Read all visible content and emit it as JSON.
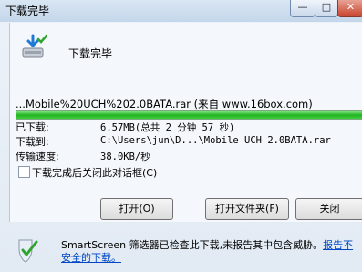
{
  "window": {
    "title": "下载完毕",
    "min_glyph": "—",
    "max_glyph": "□",
    "close_glyph": "✕"
  },
  "header": {
    "headline": "下载完毕"
  },
  "download": {
    "file_line": "...Mobile%20UCH%202.0BATA.rar (来自 www.16box.com)",
    "progress_fraction": 1.0,
    "rows": [
      {
        "label": "已下载:",
        "value": "6.57MB(总共 2 分钟 57 秒)"
      },
      {
        "label": "下载到:",
        "value": "C:\\Users\\jun\\D...\\Mobile UCH 2.0BATA.rar"
      },
      {
        "label": "传输速度:",
        "value": "38.0KB/秒"
      }
    ]
  },
  "options": {
    "close_after_download_label": "下载完成后关闭此对话框(C)",
    "close_after_download_checked": false
  },
  "buttons": {
    "open": "打开(O)",
    "open_folder": "打开文件夹(F)",
    "close": "关闭"
  },
  "smartscreen": {
    "text": "SmartScreen 筛选器已检查此下载,未报告其中包含威胁。",
    "link": "报告不安全的下载。"
  },
  "colors": {
    "progress": "#21b321",
    "link": "#0047c4"
  }
}
